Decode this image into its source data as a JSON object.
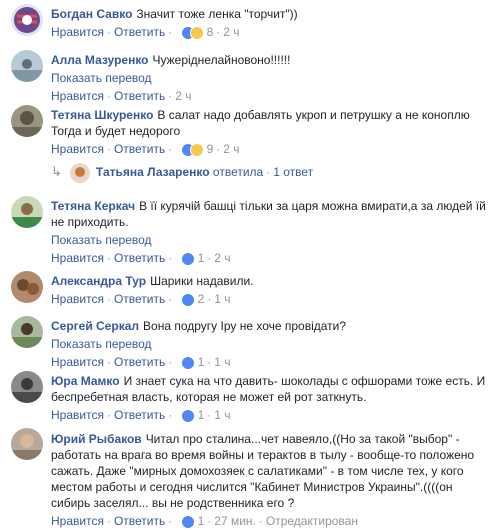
{
  "labels": {
    "like": "Нравится",
    "reply": "Ответить",
    "translate": "Показать перевод",
    "edited": "Отредактирован"
  },
  "comments": [
    {
      "author": "Богдан Савко",
      "text": "Значит тоже ленка \"торчит\"))",
      "reactions": [
        "like",
        "haha"
      ],
      "count": "8",
      "time": "2 ч",
      "avatar_color": "#6a4a8c"
    },
    {
      "author": "Алла Мазуренко",
      "text": "Чужеріднелайновоно!!!!!!",
      "translate": true,
      "time": "2 ч",
      "avatar_color": "#87a6b4"
    },
    {
      "author": "Тетяна Шкуренко",
      "text": "В салат надо добавлять укроп и петрушку а не коноплю Тогда и будет недорого",
      "reactions": [
        "like",
        "haha"
      ],
      "count": "9",
      "time": "2 ч",
      "avatar_color": "#7a7465"
    },
    {
      "author": "Тетяна Керкач",
      "text": "В її курячій башці тільки за царя можна вмирати,а за людей їй не приходить.",
      "translate": true,
      "reactions": [
        "like"
      ],
      "count": "1",
      "time": "2 ч",
      "avatar_color": "#3f8a4a"
    },
    {
      "author": "Александра Тур",
      "text": "Шарики надавили.",
      "reactions": [
        "like"
      ],
      "count": "2",
      "time": "1 ч",
      "avatar_color": "#8a5a3c"
    },
    {
      "author": "Сергей Серкал",
      "text": "Вона подругу Іру не хоче провідати?",
      "translate": true,
      "reactions": [
        "like"
      ],
      "count": "1",
      "time": "1 ч",
      "avatar_color": "#6a8a5a"
    },
    {
      "author": "Юра Мамко",
      "text": "И знает сука на что давить- шоколады с офшорами тоже есть. И беспребетная власть, которая не может ей рот заткнуть.",
      "reactions": [
        "like"
      ],
      "count": "1",
      "time": "1 ч",
      "avatar_color": "#4a4a4a"
    },
    {
      "author": "Юрий Рыбаков",
      "text": "Читал про сталина...чет навеяло,((Но за такой \"выбор\" - работать на врага во время войны и терактов в тылу - вообще-то положено сажать. Даже \"мирных домохозяек с салатиками\" - в том числе тех, у кого местом работы и сегодня числится \"Кабинет Министров Украины\".((((он сибирь заселял... вы не родственника его ?",
      "reactions": [
        "like"
      ],
      "count": "1",
      "time": "27 мин.",
      "edited": true,
      "avatar_color": "#8a7a6a"
    }
  ],
  "reply": {
    "author": "Татьяна Лазаренко",
    "action": "ответила",
    "count": "1 ответ"
  },
  "colors": {
    "link": "#385898",
    "muted": "#90949c",
    "text": "#1d2129"
  }
}
